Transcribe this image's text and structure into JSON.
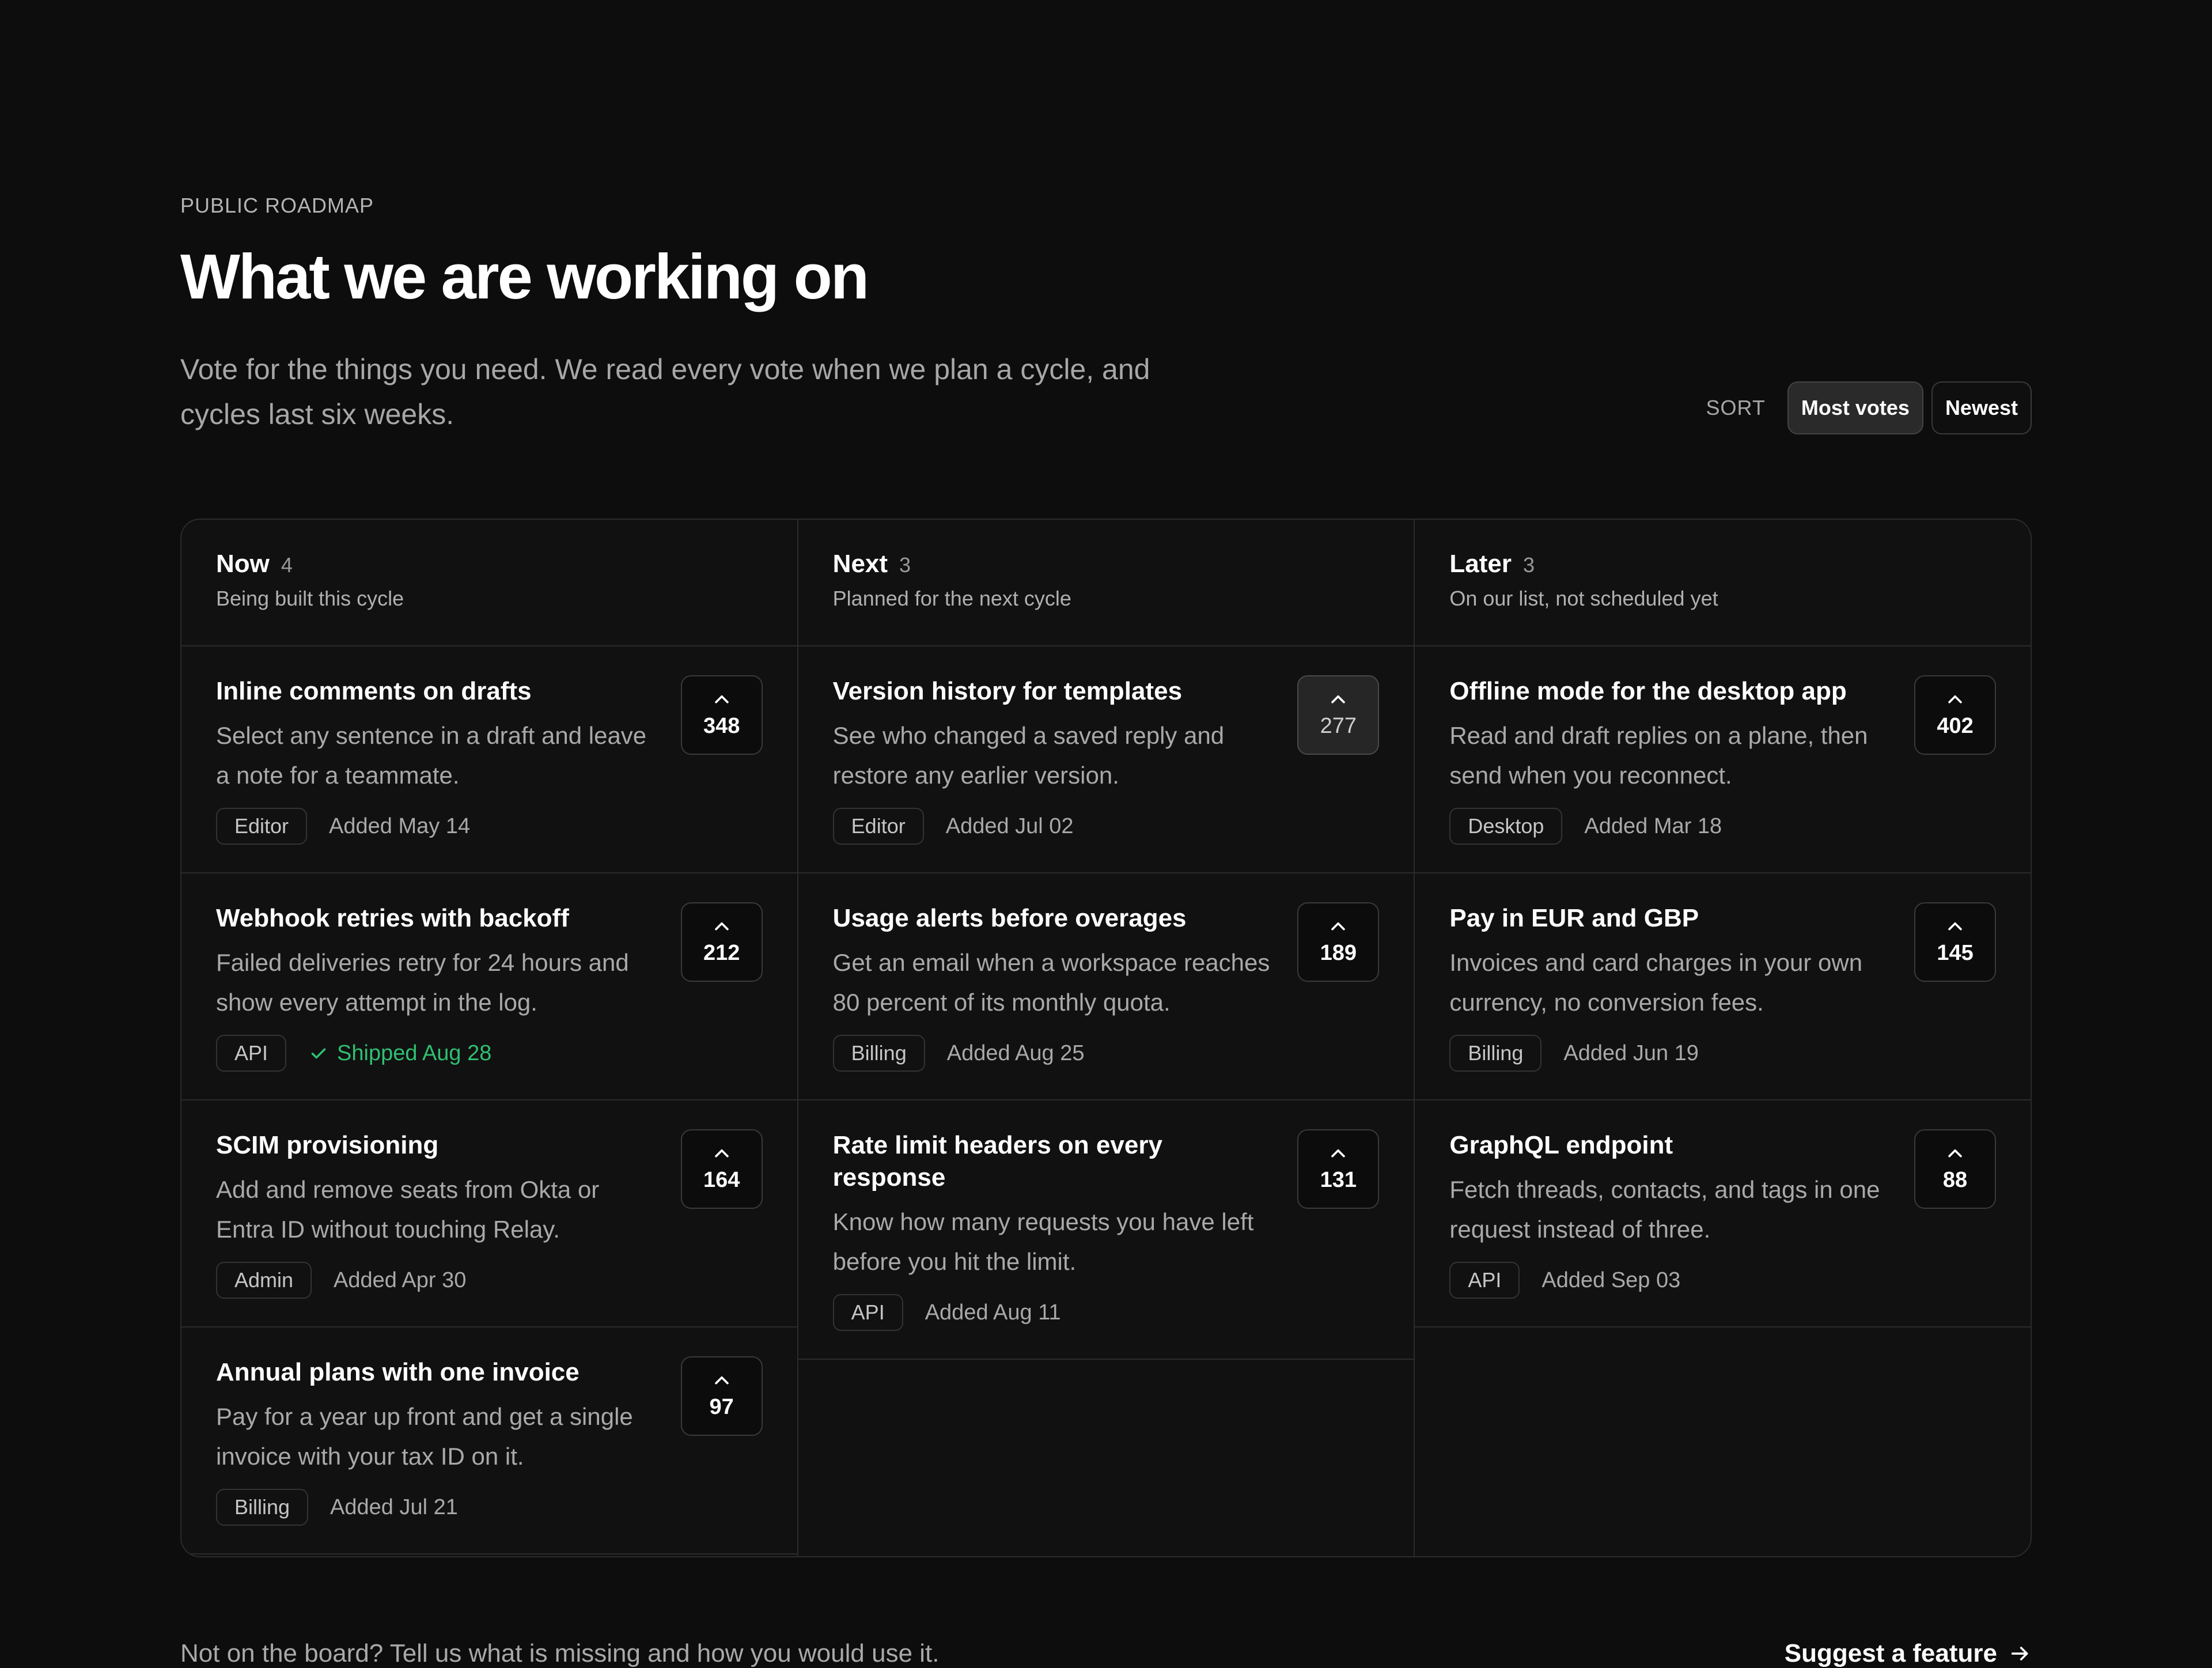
{
  "header": {
    "eyebrow": "PUBLIC ROADMAP",
    "title": "What we are working on",
    "subtitle": "Vote for the things you need. We read every vote when we plan a cycle, and cycles last six weeks."
  },
  "sort": {
    "label": "SORT",
    "options": [
      "Most votes",
      "Newest"
    ],
    "selected": "Most votes"
  },
  "columns": [
    {
      "title": "Now",
      "count": "4",
      "description": "Being built this cycle",
      "cards": [
        {
          "title": "Inline comments on drafts",
          "description": "Select any sentence in a draft and leave a note for a teammate.",
          "tag": "Editor",
          "meta": "Added May 14",
          "votes": "348",
          "voted": false,
          "shipped": false
        },
        {
          "title": "Webhook retries with backoff",
          "description": "Failed deliveries retry for 24 hours and show every attempt in the log.",
          "tag": "API",
          "meta": "Shipped Aug 28",
          "votes": "212",
          "voted": false,
          "shipped": true
        },
        {
          "title": "SCIM provisioning",
          "description": "Add and remove seats from Okta or Entra ID without touching Relay.",
          "tag": "Admin",
          "meta": "Added Apr 30",
          "votes": "164",
          "voted": false,
          "shipped": false
        },
        {
          "title": "Annual plans with one invoice",
          "description": "Pay for a year up front and get a single invoice with your tax ID on it.",
          "tag": "Billing",
          "meta": "Added Jul 21",
          "votes": "97",
          "voted": false,
          "shipped": false
        }
      ]
    },
    {
      "title": "Next",
      "count": "3",
      "description": "Planned for the next cycle",
      "cards": [
        {
          "title": "Version history for templates",
          "description": "See who changed a saved reply and restore any earlier version.",
          "tag": "Editor",
          "meta": "Added Jul 02",
          "votes": "277",
          "voted": true,
          "shipped": false
        },
        {
          "title": "Usage alerts before overages",
          "description": "Get an email when a workspace reaches 80 percent of its monthly quota.",
          "tag": "Billing",
          "meta": "Added Aug 25",
          "votes": "189",
          "voted": false,
          "shipped": false
        },
        {
          "title": "Rate limit headers on every response",
          "description": "Know how many requests you have left before you hit the limit.",
          "tag": "API",
          "meta": "Added Aug 11",
          "votes": "131",
          "voted": false,
          "shipped": false
        }
      ]
    },
    {
      "title": "Later",
      "count": "3",
      "description": "On our list, not scheduled yet",
      "cards": [
        {
          "title": "Offline mode for the desktop app",
          "description": "Read and draft replies on a plane, then send when you reconnect.",
          "tag": "Desktop",
          "meta": "Added Mar 18",
          "votes": "402",
          "voted": false,
          "shipped": false
        },
        {
          "title": "Pay in EUR and GBP",
          "description": "Invoices and card charges in your own currency, no conversion fees.",
          "tag": "Billing",
          "meta": "Added Jun 19",
          "votes": "145",
          "voted": false,
          "shipped": false
        },
        {
          "title": "GraphQL endpoint",
          "description": "Fetch threads, contacts, and tags in one request instead of three.",
          "tag": "API",
          "meta": "Added Sep 03",
          "votes": "88",
          "voted": false,
          "shipped": false
        }
      ]
    }
  ],
  "footer": {
    "note": "Not on the board? Tell us what is missing and how you would use it.",
    "link": "Suggest a feature"
  },
  "colors": {
    "background": "#0d0d0d",
    "panel": "#111111",
    "border": "#2b2b2b",
    "shipped": "#2fbf71"
  },
  "icons": {
    "vote": "chevron-up-icon",
    "shipped": "check-icon",
    "link": "arrow-right-icon"
  }
}
